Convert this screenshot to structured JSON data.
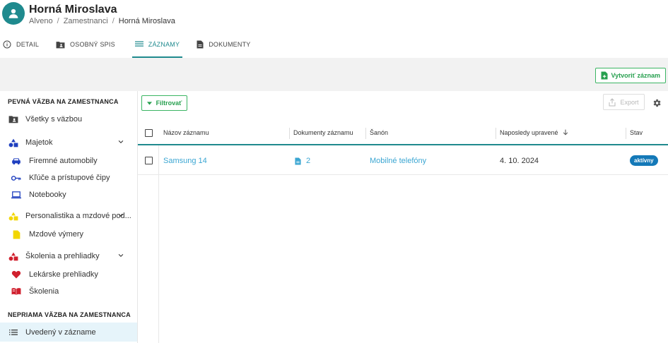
{
  "header": {
    "title": "Horná Miroslava",
    "breadcrumb": [
      "Alveno",
      "Zamestnanci",
      "Horná Miroslava"
    ]
  },
  "tabs": [
    {
      "label": "DETAIL",
      "icon": "info-icon",
      "active": false
    },
    {
      "label": "OSOBNÝ SPIS",
      "icon": "folder-person-icon",
      "active": false
    },
    {
      "label": "ZÁZNAMY",
      "icon": "list-icon",
      "active": true
    },
    {
      "label": "DOKUMENTY",
      "icon": "document-icon",
      "active": false
    }
  ],
  "toolbar": {
    "create_label": "Vytvoriť záznam",
    "filter_label": "Filtrovať",
    "export_label": "Export"
  },
  "sidebar": {
    "section1": "PEVNÁ VÄZBA NA ZAMESTNANCA",
    "section2": "NEPRIAMA VÄZBA NA ZAMESTNANCA",
    "items": [
      {
        "label": "Všetky s väzbou",
        "icon": "folder-person-icon",
        "color": "#444444"
      },
      {
        "label": "Majetok",
        "icon": "shapes-icon",
        "color": "#1f3fbf"
      },
      {
        "label": "Firemné automobily",
        "icon": "car-icon",
        "color": "#1f3fbf"
      },
      {
        "label": "Kľúče a prístupové čipy",
        "icon": "key-icon",
        "color": "#1f3fbf"
      },
      {
        "label": "Notebooky",
        "icon": "laptop-icon",
        "color": "#1f3fbf"
      },
      {
        "label": "Personalistika a mzdové pod...",
        "icon": "shapes-icon",
        "color": "#f2d600"
      },
      {
        "label": "Mzdové výmery",
        "icon": "document-icon",
        "color": "#f2d600"
      },
      {
        "label": "Školenia a prehliadky",
        "icon": "shapes-icon",
        "color": "#d0202e"
      },
      {
        "label": "Lekárske prehliadky",
        "icon": "heart-icon",
        "color": "#d0202e"
      },
      {
        "label": "Školenia",
        "icon": "book-icon",
        "color": "#d0202e"
      },
      {
        "label": "Uvedený v zázname",
        "icon": "list-icon",
        "color": "#333333"
      }
    ]
  },
  "table": {
    "columns": [
      "Názov záznamu",
      "Dokumenty záznamu",
      "Šanón",
      "Naposledy upravené",
      "Stav"
    ],
    "rows": [
      {
        "name": "Samsung 14",
        "documents": "2",
        "binder": "Mobilné telefóny",
        "updated": "4. 10. 2024",
        "status": "aktívny"
      }
    ]
  },
  "colors": {
    "accent": "#1f8a8e",
    "green": "#27a04f",
    "link": "#3ba6d2",
    "badge": "#1479b8"
  }
}
